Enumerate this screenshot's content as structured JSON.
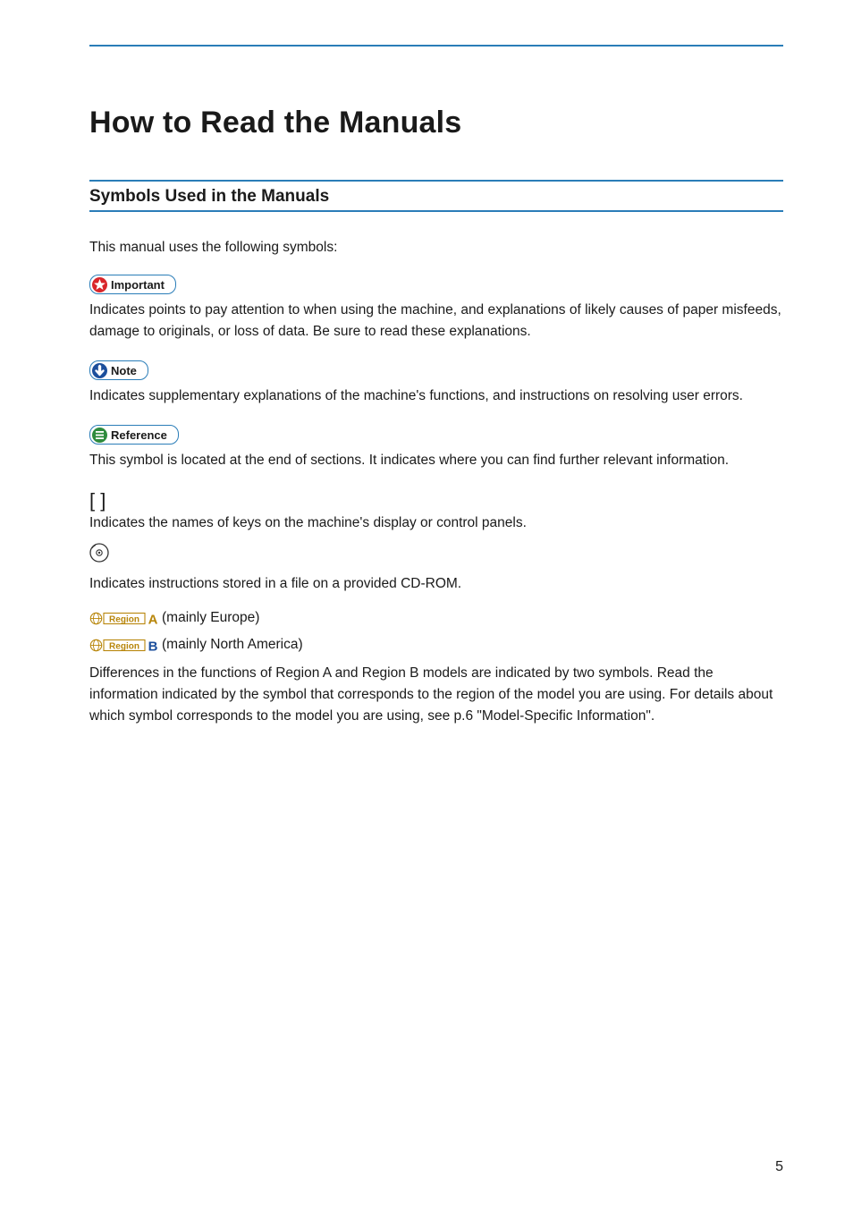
{
  "title": "How to Read the Manuals",
  "section": {
    "heading": "Symbols Used in the Manuals"
  },
  "intro": "This manual uses the following symbols:",
  "important": {
    "label": "Important",
    "text": "Indicates points to pay attention to when using the machine, and explanations of likely causes of paper misfeeds, damage to originals, or loss of data. Be sure to read these explanations."
  },
  "note": {
    "label": "Note",
    "text": "Indicates supplementary explanations of the machine's functions, and instructions on resolving user errors."
  },
  "reference": {
    "label": "Reference",
    "text": "This symbol is located at the end of sections. It indicates where you can find further relevant information."
  },
  "brackets": {
    "symbol": "[ ]",
    "text": "Indicates the names of keys on the machine's display or control panels."
  },
  "cdrom": {
    "text": "Indicates instructions stored in a file on a provided CD-ROM."
  },
  "regionA": {
    "label": "Region",
    "letter": "A",
    "suffix": "(mainly Europe)"
  },
  "regionB": {
    "label": "Region",
    "letter": "B",
    "suffix": "(mainly North America)"
  },
  "regionsText": "Differences in the functions of Region A and Region B models are indicated by two symbols. Read the information indicated by the symbol that corresponds to the region of the model you are using. For details about which symbol corresponds to the model you are using, see p.6 \"Model-Specific Information\".",
  "pageNumber": "5"
}
